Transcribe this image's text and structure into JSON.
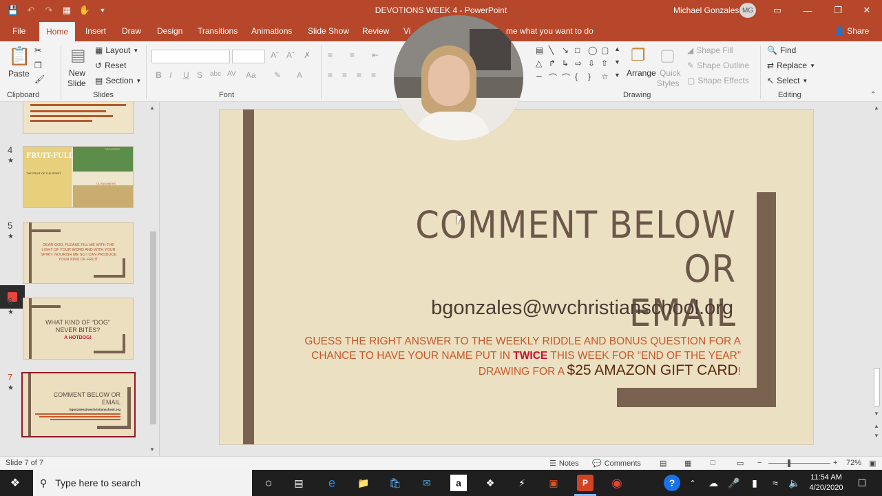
{
  "window": {
    "title": "DEVOTIONS WEEK 4  -  PowerPoint",
    "user_name": "Michael Gonzales",
    "user_initials": "MG"
  },
  "ribbon_tabs": [
    "File",
    "Home",
    "Insert",
    "Draw",
    "Design",
    "Transitions",
    "Animations",
    "Slide Show",
    "Review",
    "Vi"
  ],
  "tell_me": "me what you want to do",
  "share_label": "Share",
  "ribbon": {
    "clipboard": {
      "paste": "Paste",
      "label": "Clipboard"
    },
    "slides": {
      "new_slide": "New",
      "new_slide_2": "Slide",
      "layout": "Layout",
      "reset": "Reset",
      "section": "Section",
      "label": "Slides"
    },
    "font": {
      "label": "Font"
    },
    "drawing": {
      "arrange": "Arrange",
      "quick": "Quick",
      "styles": "Styles",
      "shape_fill": "Shape Fill",
      "shape_outline": "Shape Outline",
      "shape_effects": "Shape Effects",
      "label": "Drawing"
    },
    "editing": {
      "find": "Find",
      "replace": "Replace",
      "select": "Select",
      "label": "Editing"
    }
  },
  "thumbnails": [
    {
      "number": "4",
      "star": "★"
    },
    {
      "number": "5",
      "star": "★",
      "text": "DEAR GOD, PLEASE FILL ME WITH THE LIGHT OF YOUR WORD AND WITH YOUR SPIRIT. NOURISH ME SO I CAN PRODUCE YOUR KIND OF FRUIT."
    },
    {
      "number": "6",
      "star": "★",
      "text": "WHAT KIND OF “DOG” NEVER BITES?",
      "answer": "A HOTDOG!"
    },
    {
      "number": "7",
      "star": "★",
      "text": "COMMENT BELOW OR EMAIL",
      "email": "bgonzales@wvchristianschool.org"
    }
  ],
  "thumb4": {
    "title": "FRUIT-FULL",
    "subtitle": "THE FRUIT OF THE SPIRIT",
    "label_a": "PROVERBS",
    "label_b": "OUTNUMBERS"
  },
  "slide": {
    "title_line1": "COMMENT BELOW OR",
    "title_line2": "EMAIL",
    "email": "bgonzales@wvchristianschool.org",
    "body_part1": "GUESS THE RIGHT ANSWER TO THE WEEKLY RIDDLE AND BONUS QUESTION FOR A CHANCE TO HAVE YOUR NAME PUT IN ",
    "body_emphasis": "TWICE",
    "body_part2": " THIS WEEK FOR “END OF THE YEAR” DRAWING FOR A ",
    "body_prize": "$25 AMAZON GIFT CARD",
    "body_end": "!"
  },
  "status": {
    "slide_counter": "Slide 7 of 7",
    "notes": "Notes",
    "comments": "Comments",
    "zoom": "72%"
  },
  "taskbar": {
    "search_placeholder": "Type here to search",
    "time": "11:54 AM",
    "date": "4/20/2020"
  },
  "colors": {
    "accent": "#b7472a",
    "slide_bg": "#ece0c2",
    "frame": "#7a6251",
    "title_text": "#6c584a",
    "body_text": "#c8582a",
    "emphasis": "#c8102e"
  }
}
